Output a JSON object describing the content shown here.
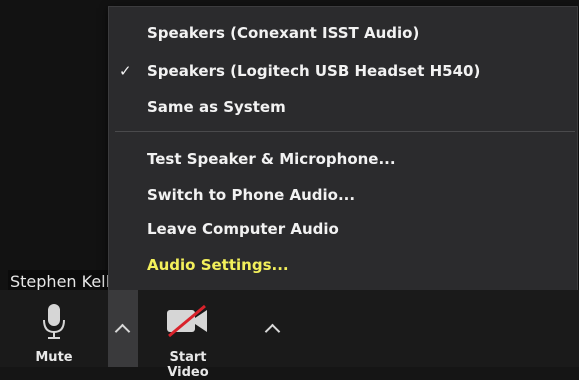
{
  "menu": {
    "speaker_section": [
      {
        "label": "Speakers (Conexant ISST Audio)",
        "checked": false
      },
      {
        "label": "Speakers (Logitech USB Headset H540)",
        "checked": true
      },
      {
        "label": "Same as System",
        "checked": false
      }
    ],
    "actions": [
      {
        "label": "Test Speaker & Microphone...",
        "highlight": false
      },
      {
        "label": "Switch to Phone Audio...",
        "highlight": false
      },
      {
        "label": "Leave Computer Audio",
        "highlight": false
      },
      {
        "label": "Audio Settings...",
        "highlight": true
      }
    ],
    "check_glyph": "✓"
  },
  "participant": {
    "name": "Stephen Kelly"
  },
  "toolbar": {
    "mute_label": "Mute",
    "start_video_label": "Start Video"
  },
  "colors": {
    "highlight": "#f3f05b",
    "menu_bg": "#2b2b2d",
    "video_off_red": "#d9222b"
  }
}
